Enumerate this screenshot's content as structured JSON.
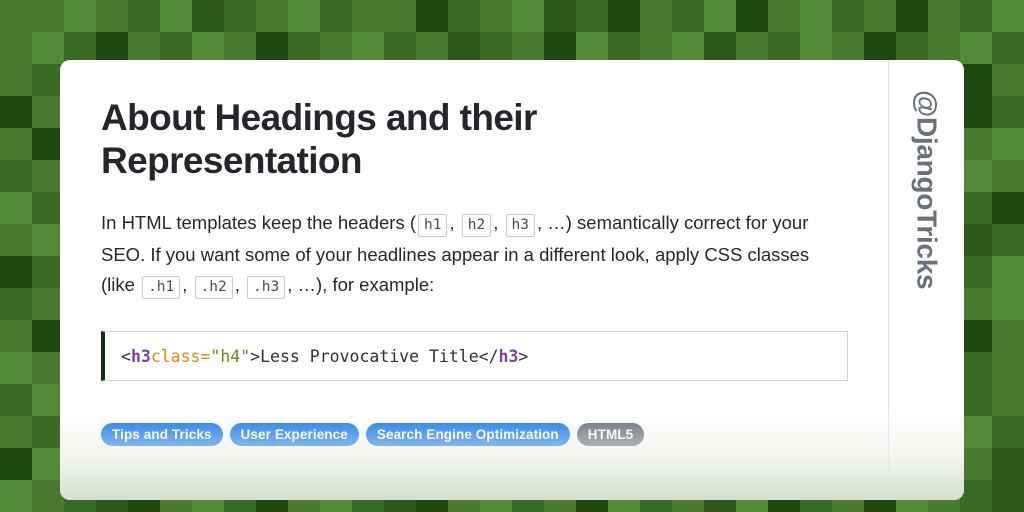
{
  "background": {
    "name": "checkered-green-pattern",
    "palette": [
      "#4a7a30",
      "#477a2e",
      "#3a6b24",
      "#346320",
      "#2d5a1c",
      "#1e4a10",
      "#16400a",
      "#538a38"
    ],
    "grid": {
      "cols": 32,
      "rows": 16,
      "cell": 32
    },
    "cells": [
      0,
      0,
      7,
      0,
      2,
      7,
      4,
      2,
      0,
      7,
      2,
      0,
      0,
      5,
      2,
      0,
      7,
      4,
      2,
      5,
      0,
      2,
      7,
      5,
      0,
      7,
      2,
      0,
      5,
      0,
      2,
      7,
      0,
      7,
      2,
      5,
      0,
      2,
      7,
      0,
      5,
      2,
      0,
      7,
      2,
      0,
      4,
      2,
      0,
      5,
      7,
      2,
      0,
      7,
      4,
      0,
      2,
      7,
      0,
      5,
      2,
      0,
      7,
      2,
      0,
      2,
      7,
      5,
      4,
      0,
      2,
      7,
      0,
      2,
      5,
      0,
      7,
      2,
      0,
      5,
      2,
      7,
      0,
      2,
      4,
      0,
      7,
      2,
      5,
      0,
      2,
      7,
      0,
      2,
      5,
      0,
      5,
      0,
      2,
      4,
      7,
      5,
      0,
      2,
      7,
      0,
      2,
      5,
      0,
      7,
      4,
      2,
      0,
      5,
      7,
      0,
      2,
      7,
      0,
      5,
      2,
      0,
      7,
      2,
      4,
      0,
      5,
      2,
      0,
      5,
      7,
      2,
      0,
      7,
      5,
      0,
      2,
      4,
      7,
      0,
      5,
      2,
      0,
      7,
      2,
      0,
      4,
      5,
      7,
      2,
      0,
      5,
      0,
      7,
      2,
      0,
      5,
      2,
      0,
      7,
      2,
      0,
      5,
      7,
      4,
      0,
      2,
      5,
      0,
      7,
      2,
      0,
      7,
      5,
      2,
      0,
      4,
      7,
      0,
      2,
      5,
      0,
      7,
      2,
      0,
      5,
      7,
      0,
      2,
      4,
      7,
      0,
      7,
      2,
      0,
      5,
      2,
      7,
      0,
      4,
      5,
      0,
      7,
      2,
      0,
      5,
      7,
      2,
      0,
      2,
      5,
      7,
      0,
      4,
      2,
      0,
      7,
      2,
      0,
      5,
      7,
      0,
      2,
      5,
      0,
      7,
      5,
      2,
      0,
      5,
      7,
      2,
      4,
      0,
      5,
      7,
      2,
      0,
      2,
      5,
      7,
      0,
      4,
      2,
      0,
      7,
      5,
      2,
      0,
      7,
      2,
      5,
      0,
      7,
      4,
      2,
      5,
      2,
      0,
      7,
      5,
      0,
      2,
      7,
      0,
      4,
      2,
      5,
      7,
      0,
      2,
      0,
      5,
      7,
      2,
      0,
      7,
      5,
      0,
      2,
      4,
      0,
      7,
      2,
      5,
      0,
      2,
      7,
      2,
      0,
      7,
      4,
      2,
      5,
      0,
      7,
      2,
      0,
      5,
      2,
      0,
      7,
      5,
      2,
      4,
      0,
      7,
      2,
      0,
      5,
      7,
      0,
      2,
      7,
      5,
      0,
      2,
      4,
      0,
      7,
      0,
      5,
      2,
      7,
      0,
      2,
      4,
      5,
      7,
      0,
      2,
      7,
      5,
      0,
      2,
      0,
      7,
      2,
      5,
      4,
      0,
      7,
      2,
      0,
      5,
      2,
      0,
      7,
      4,
      2,
      5,
      0,
      7,
      0,
      2,
      5,
      7,
      4,
      0,
      2,
      5,
      7,
      0,
      2,
      0,
      5,
      7,
      2,
      0,
      4,
      2,
      7,
      5,
      0,
      2,
      7,
      0,
      5,
      2,
      4,
      0,
      7,
      2,
      0,
      2,
      7,
      0,
      5,
      2,
      0,
      7,
      5,
      0,
      2,
      4,
      7,
      2,
      0,
      5,
      7,
      2,
      0,
      7,
      5,
      0,
      2,
      4,
      5,
      7,
      0,
      2,
      0,
      7,
      5,
      2,
      0,
      0,
      2,
      5,
      7,
      0,
      4,
      2,
      0,
      5,
      7,
      2,
      0,
      7,
      2,
      5,
      0,
      4,
      7,
      0,
      2,
      5,
      7,
      0,
      2,
      7,
      4,
      0,
      5,
      2,
      0,
      7,
      2,
      5,
      7,
      2,
      0,
      4,
      7,
      5,
      2,
      0,
      7,
      0,
      2,
      5,
      4,
      7,
      0,
      2,
      5,
      7,
      0,
      2,
      4,
      5,
      0,
      7,
      2,
      0,
      7,
      5,
      2,
      0,
      4,
      7,
      0,
      2,
      4,
      5,
      0,
      7,
      2,
      5,
      0,
      7,
      2,
      4,
      5,
      0,
      7,
      2,
      0,
      5,
      7,
      2,
      0,
      4,
      7,
      5,
      2,
      0,
      5,
      7,
      0,
      2,
      4
    ]
  },
  "card": {
    "page_title": "About Headings and their Representation",
    "paragraph": {
      "part1": "In HTML templates keep the headers (",
      "code1": "h1",
      "sep1": ",",
      "code2": "h2",
      "sep2": ",",
      "code3": "h3",
      "part2": ", …) semantically correct for your SEO. If you want some of your headlines appear in a different look, apply CSS classes (like",
      "code4": ".h1",
      "sep3": ",",
      "code5": ".h2",
      "sep4": ",",
      "code6": ".h3",
      "part3": ", …), for example:"
    },
    "code_block": {
      "open_lt": "<",
      "open_tag": "h3",
      "space": " ",
      "attr_name": "class",
      "equals": "=",
      "attr_value": "\"h4\"",
      "open_gt": ">",
      "text": "Less Provocative Title",
      "close_lt": "</",
      "close_tag": "h3",
      "close_gt": ">"
    },
    "tags": [
      {
        "label": "Tips and Tricks",
        "style": "blue"
      },
      {
        "label": "User Experience",
        "style": "blue"
      },
      {
        "label": "Search Engine Optimization",
        "style": "blue"
      },
      {
        "label": "HTML5",
        "style": "gray"
      }
    ],
    "handle": "@DjangoTricks"
  },
  "colors": {
    "accent_blue": "#1a7bf0",
    "tag_gray": "#6a717c",
    "title_ink": "#24262b",
    "code_tag": "#7d3f9e",
    "code_attr": "#e8860c",
    "code_string": "#6a8d1f",
    "code_bar": "#113018"
  }
}
